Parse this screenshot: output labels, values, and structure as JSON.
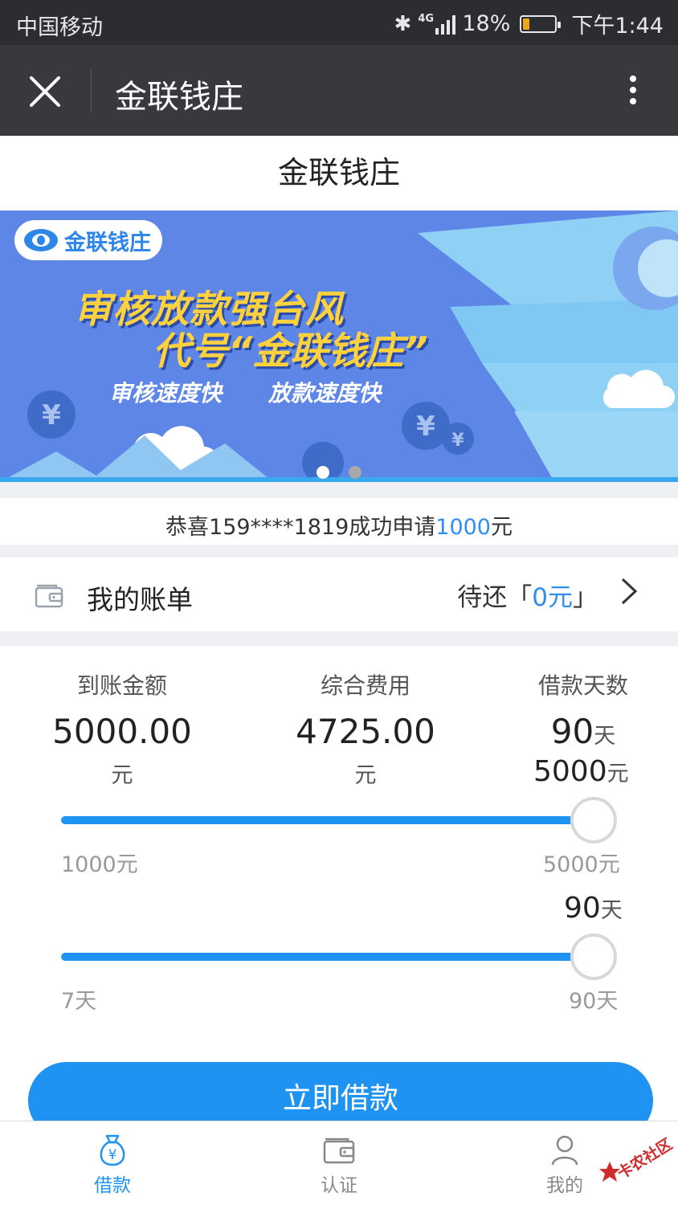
{
  "status_bar": {
    "carrier": "中国移动",
    "network": "4G",
    "battery": "18%",
    "time": "下午1:44"
  },
  "title_bar": {
    "title": "金联钱庄"
  },
  "page": {
    "title": "金联钱庄"
  },
  "banner": {
    "logo_text": "金联钱庄",
    "headline_line1": "审核放款强台风",
    "headline_line2": "代号“金联钱庄”",
    "sub1": "审核速度快",
    "sub2": "放款速度快",
    "active_slide": 1,
    "slide_count": 2
  },
  "notice": {
    "prefix": "恭喜159****1819成功申请",
    "amount": "1000",
    "suffix": "元"
  },
  "bill": {
    "label": "我的账单",
    "due_prefix": "待还「",
    "due_amount": "0元",
    "due_suffix": "」"
  },
  "stats": {
    "received": {
      "caption": "到账金额",
      "value": "5000.00",
      "unit": "元"
    },
    "fee": {
      "caption": "综合费用",
      "value": "4725.00",
      "unit": "元"
    },
    "days": {
      "caption": "借款天数",
      "value": "90",
      "unit": "天"
    }
  },
  "amount_slider": {
    "current_value": "5000",
    "current_unit": "元",
    "min_label": "1000元",
    "max_label": "5000元",
    "min": 1000,
    "max": 5000,
    "value": 5000
  },
  "days_slider": {
    "current_value": "90",
    "current_unit": "天",
    "min_label": "7天",
    "max_label": "90天",
    "min": 7,
    "max": 90,
    "value": 90
  },
  "apply_button": {
    "label": "立即借款"
  },
  "bottom_nav": {
    "items": [
      {
        "label": "借款",
        "icon": "money-bag-icon",
        "active": true
      },
      {
        "label": "认证",
        "icon": "wallet-icon",
        "active": false
      },
      {
        "label": "我的",
        "icon": "user-icon",
        "active": false
      }
    ]
  },
  "watermark": {
    "text": "卡农社区"
  },
  "colors": {
    "accent": "#1e93f2",
    "highlight_text": "#2e8ff0",
    "top_bar": "#37393d",
    "banner_bg": "#5d86e6",
    "banner_headline": "#ffd23d"
  }
}
